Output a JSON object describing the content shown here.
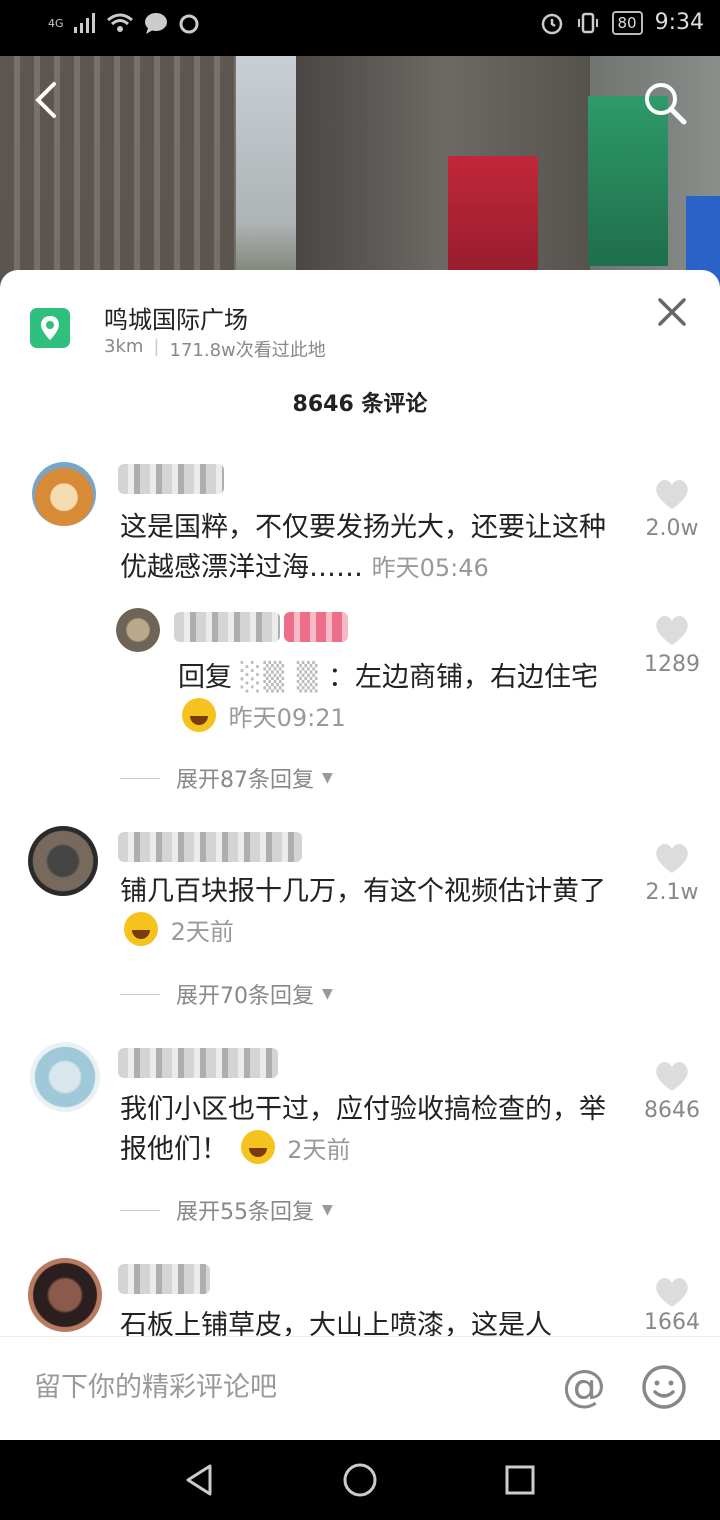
{
  "status_bar": {
    "network": "4G",
    "battery": "80",
    "time": "9:34"
  },
  "location": {
    "name": "鸣城国际广场",
    "distance": "3km",
    "views": "171.8w次看过此地"
  },
  "comment_count": "8646 条评论",
  "comments": [
    {
      "text": "这是国粹，不仅要发扬光大，还要让这种优越感漂洋过海……",
      "time": "昨天05:46",
      "likes": "2.0w"
    },
    {
      "reply_prefix": "回复",
      "reply_text": "：左边商铺，右边住宅",
      "time": "昨天09:21",
      "likes": "1289"
    },
    {
      "expand": "展开87条回复"
    },
    {
      "text": "铺几百块报十几万，有这个视频估计黄了",
      "time": "2天前",
      "likes": "2.1w"
    },
    {
      "expand": "展开70条回复"
    },
    {
      "text": "我们小区也干过，应付验收搞检查的，举报他们！",
      "time": "2天前",
      "likes": "8646"
    },
    {
      "expand": "展开55条回复"
    },
    {
      "text": "石板上铺草皮，大山上喷漆，这是人",
      "likes": "1664"
    }
  ],
  "input": {
    "placeholder": "留下你的精彩评论吧"
  },
  "icons": {
    "back": "chevron-left-icon",
    "search": "search-icon",
    "close": "close-icon",
    "location": "location-pin-icon",
    "heart": "heart-icon",
    "at": "at-icon",
    "emoji": "emoji-icon"
  },
  "colors": {
    "location_green": "#2ec07c",
    "heart_gray": "#dcdcdc"
  }
}
